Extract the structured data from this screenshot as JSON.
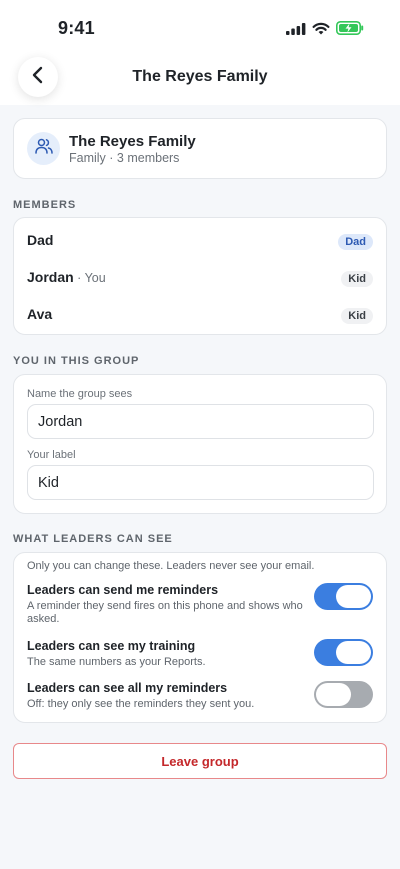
{
  "status_bar": {
    "time": "9:41",
    "icons": [
      "cellular-signal-icon",
      "wifi-icon",
      "battery-charging-icon"
    ],
    "battery_color": "#34c759"
  },
  "header": {
    "title": "The Reyes Family",
    "back_icon": "chevron-left-icon"
  },
  "group": {
    "icon": "users-icon",
    "name": "The Reyes Family",
    "subtitle": "Family · 3 members"
  },
  "members": {
    "section_label": "MEMBERS",
    "items": [
      {
        "name": "Dad",
        "suffix": "",
        "role": "Dad"
      },
      {
        "name": "Jordan",
        "suffix": " · You",
        "role": "Kid"
      },
      {
        "name": "Ava",
        "suffix": "",
        "role": "Kid"
      }
    ]
  },
  "you_in_group": {
    "section_label": "YOU IN THIS GROUP",
    "display_name_label": "Name the group sees",
    "display_name_value": "Jordan",
    "your_label_label": "Your label",
    "your_label_value": "Kid"
  },
  "leaders": {
    "section_label": "WHAT LEADERS CAN SEE",
    "note": "Only you can change these. Leaders never see your email.",
    "toggles": [
      {
        "title": "Leaders can send me reminders",
        "description": "A reminder they send fires on this phone and shows who asked.",
        "on": true
      },
      {
        "title": "Leaders can see my training",
        "description": "The same numbers as your Reports.",
        "on": true
      },
      {
        "title": "Leaders can see all my reminders",
        "description": "Off: they only see the reminders they sent you.",
        "on": false
      }
    ]
  },
  "actions": {
    "leave_label": "Leave group"
  },
  "colors": {
    "accent": "#3b7ee0",
    "danger": "#c4282b",
    "toggle_off": "#a7abb0"
  }
}
